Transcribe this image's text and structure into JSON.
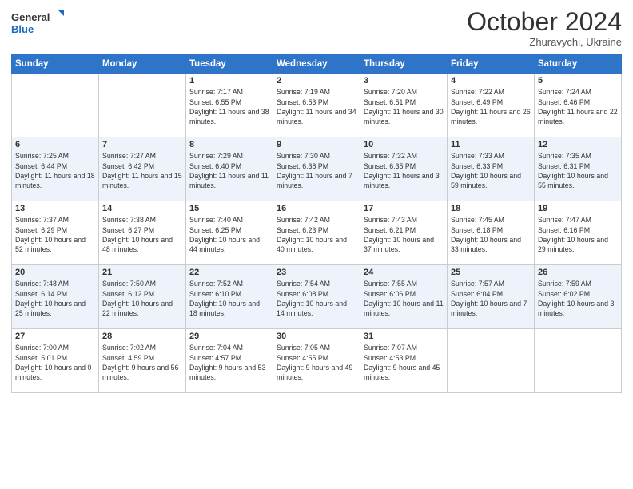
{
  "header": {
    "logo_general": "General",
    "logo_blue": "Blue",
    "month": "October 2024",
    "location": "Zhuravychi, Ukraine"
  },
  "days_of_week": [
    "Sunday",
    "Monday",
    "Tuesday",
    "Wednesday",
    "Thursday",
    "Friday",
    "Saturday"
  ],
  "weeks": [
    [
      {
        "day": "",
        "sunrise": "",
        "sunset": "",
        "daylight": ""
      },
      {
        "day": "",
        "sunrise": "",
        "sunset": "",
        "daylight": ""
      },
      {
        "day": "1",
        "sunrise": "Sunrise: 7:17 AM",
        "sunset": "Sunset: 6:55 PM",
        "daylight": "Daylight: 11 hours and 38 minutes."
      },
      {
        "day": "2",
        "sunrise": "Sunrise: 7:19 AM",
        "sunset": "Sunset: 6:53 PM",
        "daylight": "Daylight: 11 hours and 34 minutes."
      },
      {
        "day": "3",
        "sunrise": "Sunrise: 7:20 AM",
        "sunset": "Sunset: 6:51 PM",
        "daylight": "Daylight: 11 hours and 30 minutes."
      },
      {
        "day": "4",
        "sunrise": "Sunrise: 7:22 AM",
        "sunset": "Sunset: 6:49 PM",
        "daylight": "Daylight: 11 hours and 26 minutes."
      },
      {
        "day": "5",
        "sunrise": "Sunrise: 7:24 AM",
        "sunset": "Sunset: 6:46 PM",
        "daylight": "Daylight: 11 hours and 22 minutes."
      }
    ],
    [
      {
        "day": "6",
        "sunrise": "Sunrise: 7:25 AM",
        "sunset": "Sunset: 6:44 PM",
        "daylight": "Daylight: 11 hours and 18 minutes."
      },
      {
        "day": "7",
        "sunrise": "Sunrise: 7:27 AM",
        "sunset": "Sunset: 6:42 PM",
        "daylight": "Daylight: 11 hours and 15 minutes."
      },
      {
        "day": "8",
        "sunrise": "Sunrise: 7:29 AM",
        "sunset": "Sunset: 6:40 PM",
        "daylight": "Daylight: 11 hours and 11 minutes."
      },
      {
        "day": "9",
        "sunrise": "Sunrise: 7:30 AM",
        "sunset": "Sunset: 6:38 PM",
        "daylight": "Daylight: 11 hours and 7 minutes."
      },
      {
        "day": "10",
        "sunrise": "Sunrise: 7:32 AM",
        "sunset": "Sunset: 6:35 PM",
        "daylight": "Daylight: 11 hours and 3 minutes."
      },
      {
        "day": "11",
        "sunrise": "Sunrise: 7:33 AM",
        "sunset": "Sunset: 6:33 PM",
        "daylight": "Daylight: 10 hours and 59 minutes."
      },
      {
        "day": "12",
        "sunrise": "Sunrise: 7:35 AM",
        "sunset": "Sunset: 6:31 PM",
        "daylight": "Daylight: 10 hours and 55 minutes."
      }
    ],
    [
      {
        "day": "13",
        "sunrise": "Sunrise: 7:37 AM",
        "sunset": "Sunset: 6:29 PM",
        "daylight": "Daylight: 10 hours and 52 minutes."
      },
      {
        "day": "14",
        "sunrise": "Sunrise: 7:38 AM",
        "sunset": "Sunset: 6:27 PM",
        "daylight": "Daylight: 10 hours and 48 minutes."
      },
      {
        "day": "15",
        "sunrise": "Sunrise: 7:40 AM",
        "sunset": "Sunset: 6:25 PM",
        "daylight": "Daylight: 10 hours and 44 minutes."
      },
      {
        "day": "16",
        "sunrise": "Sunrise: 7:42 AM",
        "sunset": "Sunset: 6:23 PM",
        "daylight": "Daylight: 10 hours and 40 minutes."
      },
      {
        "day": "17",
        "sunrise": "Sunrise: 7:43 AM",
        "sunset": "Sunset: 6:21 PM",
        "daylight": "Daylight: 10 hours and 37 minutes."
      },
      {
        "day": "18",
        "sunrise": "Sunrise: 7:45 AM",
        "sunset": "Sunset: 6:18 PM",
        "daylight": "Daylight: 10 hours and 33 minutes."
      },
      {
        "day": "19",
        "sunrise": "Sunrise: 7:47 AM",
        "sunset": "Sunset: 6:16 PM",
        "daylight": "Daylight: 10 hours and 29 minutes."
      }
    ],
    [
      {
        "day": "20",
        "sunrise": "Sunrise: 7:48 AM",
        "sunset": "Sunset: 6:14 PM",
        "daylight": "Daylight: 10 hours and 25 minutes."
      },
      {
        "day": "21",
        "sunrise": "Sunrise: 7:50 AM",
        "sunset": "Sunset: 6:12 PM",
        "daylight": "Daylight: 10 hours and 22 minutes."
      },
      {
        "day": "22",
        "sunrise": "Sunrise: 7:52 AM",
        "sunset": "Sunset: 6:10 PM",
        "daylight": "Daylight: 10 hours and 18 minutes."
      },
      {
        "day": "23",
        "sunrise": "Sunrise: 7:54 AM",
        "sunset": "Sunset: 6:08 PM",
        "daylight": "Daylight: 10 hours and 14 minutes."
      },
      {
        "day": "24",
        "sunrise": "Sunrise: 7:55 AM",
        "sunset": "Sunset: 6:06 PM",
        "daylight": "Daylight: 10 hours and 11 minutes."
      },
      {
        "day": "25",
        "sunrise": "Sunrise: 7:57 AM",
        "sunset": "Sunset: 6:04 PM",
        "daylight": "Daylight: 10 hours and 7 minutes."
      },
      {
        "day": "26",
        "sunrise": "Sunrise: 7:59 AM",
        "sunset": "Sunset: 6:02 PM",
        "daylight": "Daylight: 10 hours and 3 minutes."
      }
    ],
    [
      {
        "day": "27",
        "sunrise": "Sunrise: 7:00 AM",
        "sunset": "Sunset: 5:01 PM",
        "daylight": "Daylight: 10 hours and 0 minutes."
      },
      {
        "day": "28",
        "sunrise": "Sunrise: 7:02 AM",
        "sunset": "Sunset: 4:59 PM",
        "daylight": "Daylight: 9 hours and 56 minutes."
      },
      {
        "day": "29",
        "sunrise": "Sunrise: 7:04 AM",
        "sunset": "Sunset: 4:57 PM",
        "daylight": "Daylight: 9 hours and 53 minutes."
      },
      {
        "day": "30",
        "sunrise": "Sunrise: 7:05 AM",
        "sunset": "Sunset: 4:55 PM",
        "daylight": "Daylight: 9 hours and 49 minutes."
      },
      {
        "day": "31",
        "sunrise": "Sunrise: 7:07 AM",
        "sunset": "Sunset: 4:53 PM",
        "daylight": "Daylight: 9 hours and 45 minutes."
      },
      {
        "day": "",
        "sunrise": "",
        "sunset": "",
        "daylight": ""
      },
      {
        "day": "",
        "sunrise": "",
        "sunset": "",
        "daylight": ""
      }
    ]
  ]
}
